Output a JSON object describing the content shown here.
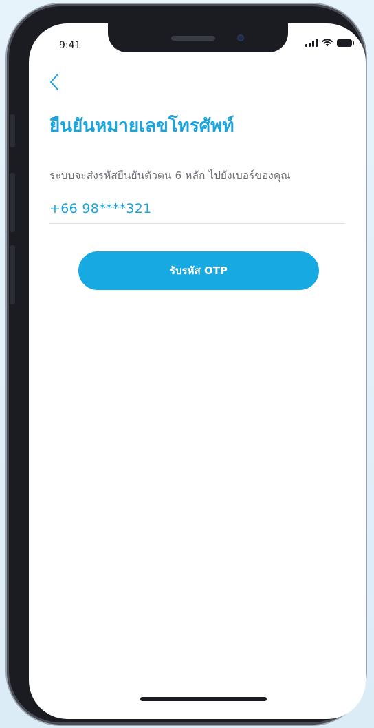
{
  "status_bar": {
    "time": "9:41"
  },
  "header": {
    "back_icon": "chevron-left-icon",
    "title": "ยืนยันหมายเลขโทรศัพท์"
  },
  "form": {
    "instruction": "ระบบจะส่งรหัสยืนยันตัวตน 6 หลัก ไปยังเบอร์ของคุณ",
    "phone_number": "+66 98****321",
    "request_otp_label": "รับรหัส OTP"
  },
  "colors": {
    "accent": "#1ba3de",
    "button": "#17a9e2",
    "background": "#ffffff"
  }
}
